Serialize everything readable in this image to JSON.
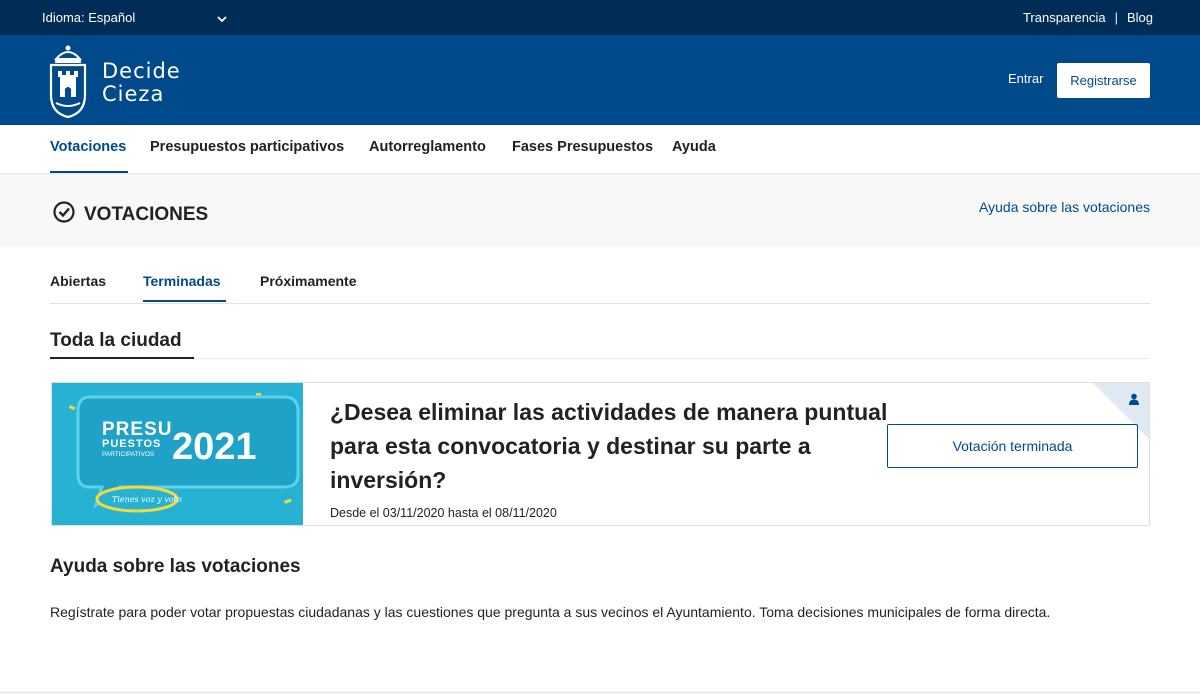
{
  "topbar": {
    "language_label": "Idioma:",
    "language_value": "Español",
    "links": [
      "Transparencia",
      "Blog"
    ],
    "separator": "|"
  },
  "header": {
    "brand_line1": "Decide",
    "brand_line2": "Cieza",
    "login_link": "Entrar",
    "register_button": "Registrarse"
  },
  "nav": {
    "items": [
      "Votaciones",
      "Presupuestos participativos",
      "Autorreglamento",
      "Fases Presupuestos",
      "Ayuda"
    ],
    "active": "Votaciones"
  },
  "section": {
    "title": "VOTACIONES",
    "help_link": "Ayuda sobre las votaciones"
  },
  "tabs": {
    "items": [
      "Abiertas",
      "Terminadas",
      "Próximamente"
    ],
    "active": "Terminadas"
  },
  "scope": {
    "title": "Toda la ciudad"
  },
  "poll": {
    "title": "¿Desea eliminar las actividades de manera puntual para esta convocatoria y destinar su parte a inversión?",
    "dates": "Desde el 03/11/2020 hasta el 08/11/2020",
    "status_button": "Votación terminada",
    "image": {
      "line1": "PRESU",
      "line2": "PUESTOS",
      "line3": "PARTICIPATIVOS",
      "year": "2021",
      "slogan": "Tienes voz y voto"
    }
  },
  "help": {
    "title": "Ayuda sobre las votaciones",
    "text": "Regístrate para poder votar propuestas ciudadanas y las cuestiones que pregunta a sus vecinos el Ayuntamiento. Toma decisiones municipales de forma directa."
  },
  "colors": {
    "topbar": "#002d56",
    "header": "#004a8c",
    "accent": "#004a8c",
    "image_bg": "#27b2d3"
  }
}
